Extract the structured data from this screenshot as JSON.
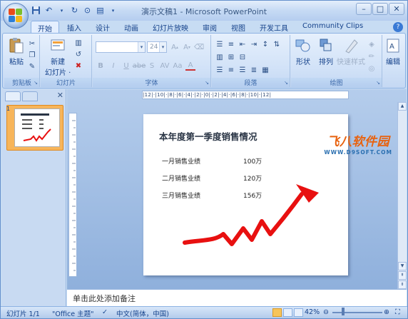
{
  "window": {
    "title": "演示文稿1 - Microsoft PowerPoint"
  },
  "qat": {
    "save_icon": "save-icon",
    "undo_icon": "undo-icon",
    "redo_icon": "redo-icon"
  },
  "tabs": [
    {
      "label": "开始",
      "active": true
    },
    {
      "label": "插入"
    },
    {
      "label": "设计"
    },
    {
      "label": "动画"
    },
    {
      "label": "幻灯片放映"
    },
    {
      "label": "审阅"
    },
    {
      "label": "视图"
    },
    {
      "label": "开发工具"
    },
    {
      "label": "Community Clips"
    }
  ],
  "ribbon": {
    "clipboard": {
      "paste_label": "粘贴",
      "group_label": "剪贴板"
    },
    "slides": {
      "new_slide_label": "新建\n幻灯片",
      "new_slide_line1": "新建",
      "new_slide_line2": "幻灯片 ·",
      "group_label": "幻灯片"
    },
    "font": {
      "font_name": "",
      "font_size": "24",
      "group_label": "字体"
    },
    "paragraph": {
      "group_label": "段落"
    },
    "drawing": {
      "shape_label": "形状",
      "arrange_label": "排列",
      "quick_style_label": "快速样式",
      "group_label": "绘图"
    },
    "editing": {
      "edit_label": "编辑"
    }
  },
  "slide_pane": {
    "slide_number": "1"
  },
  "ruler": {
    "text": "|12|·|10|·|8|·|6|·|4|·|2|·|0|·|2|·|4|·|6|·|8|·|10|·|12|"
  },
  "slide": {
    "title": "本年度第一季度销售情况",
    "rows": [
      {
        "label": "一月销售业绩",
        "value": "100万"
      },
      {
        "label": "二月销售业绩",
        "value": "120万"
      },
      {
        "label": "三月销售业绩",
        "value": "156万"
      }
    ]
  },
  "watermark": {
    "main": "飞八软件园",
    "sub": "WWW.D9SOFT.COM"
  },
  "notes": {
    "placeholder": "单击此处添加备注"
  },
  "statusbar": {
    "slide_info": "幻灯片 1/1",
    "theme": "\"Office 主题\"",
    "language": "中文(简体，中国)",
    "zoom": "42%"
  },
  "colors": {
    "accent": "#e8620f",
    "arrow": "#e81010",
    "ribbon_bg": "#d3e3f8"
  }
}
